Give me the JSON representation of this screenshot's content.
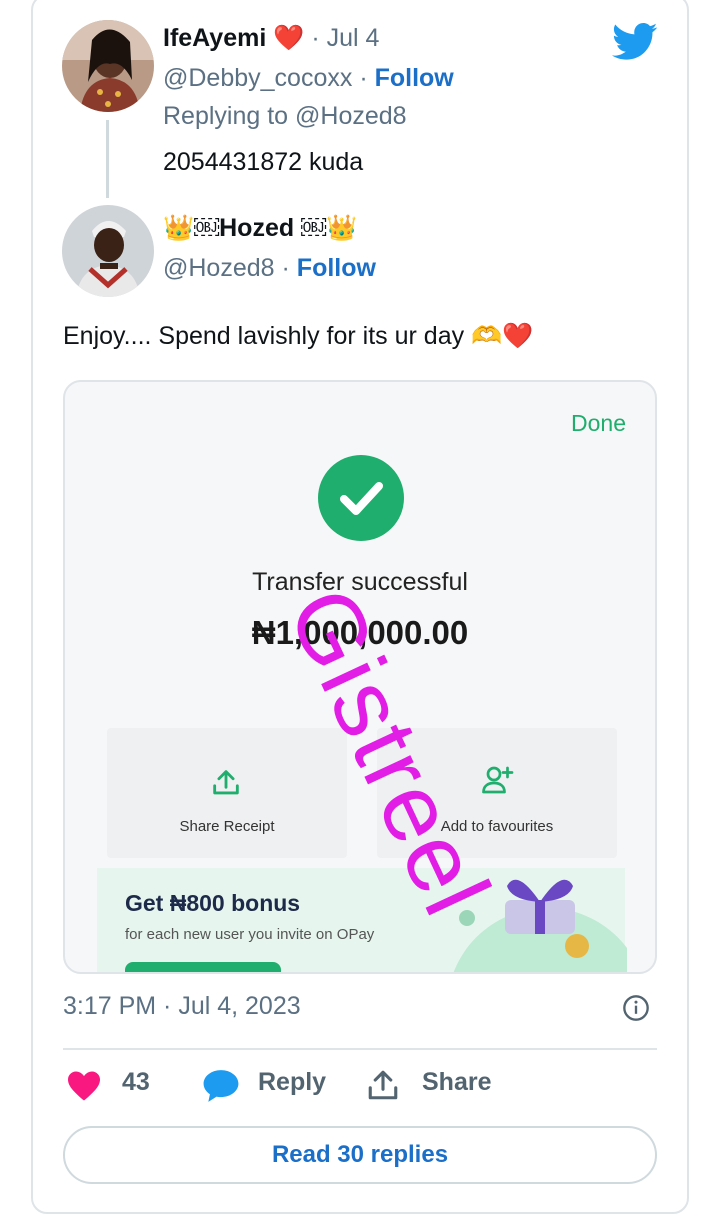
{
  "reply": {
    "author_name": "IfeAyemi",
    "heart_emoji": "❤️",
    "date": "· Jul 4",
    "handle": "@Debby_cocoxx",
    "follow_sep": "·",
    "follow_label": "Follow",
    "replying_to": "Replying to @Hozed8",
    "text": "2054431872 kuda"
  },
  "main": {
    "author_name": "👑￼Hozed ￼👑",
    "handle": "@Hozed8",
    "follow_sep": "·",
    "follow_label": "Follow",
    "text": "Enjoy.... Spend lavishly for its ur day 🫶❤️"
  },
  "receipt": {
    "done_label": "Done",
    "status": "Transfer successful",
    "amount": "₦1,000,000.00",
    "share_label": "Share Receipt",
    "favourites_label": "Add to favourites",
    "promo_title": "Get ₦800 bonus",
    "promo_subtitle": "for each new user you invite on OPay",
    "watermark": "Gistreel",
    "accent_color": "#1fae6d",
    "watermark_color": "#e21de6"
  },
  "meta": {
    "timestamp": "3:17 PM · Jul 4, 2023"
  },
  "actions": {
    "like_count": "43",
    "reply_label": "Reply",
    "share_label": "Share",
    "read_replies": "Read 30 replies"
  },
  "colors": {
    "link": "#1b6fc8",
    "like": "#f91880",
    "twitter": "#1d9bf0"
  }
}
